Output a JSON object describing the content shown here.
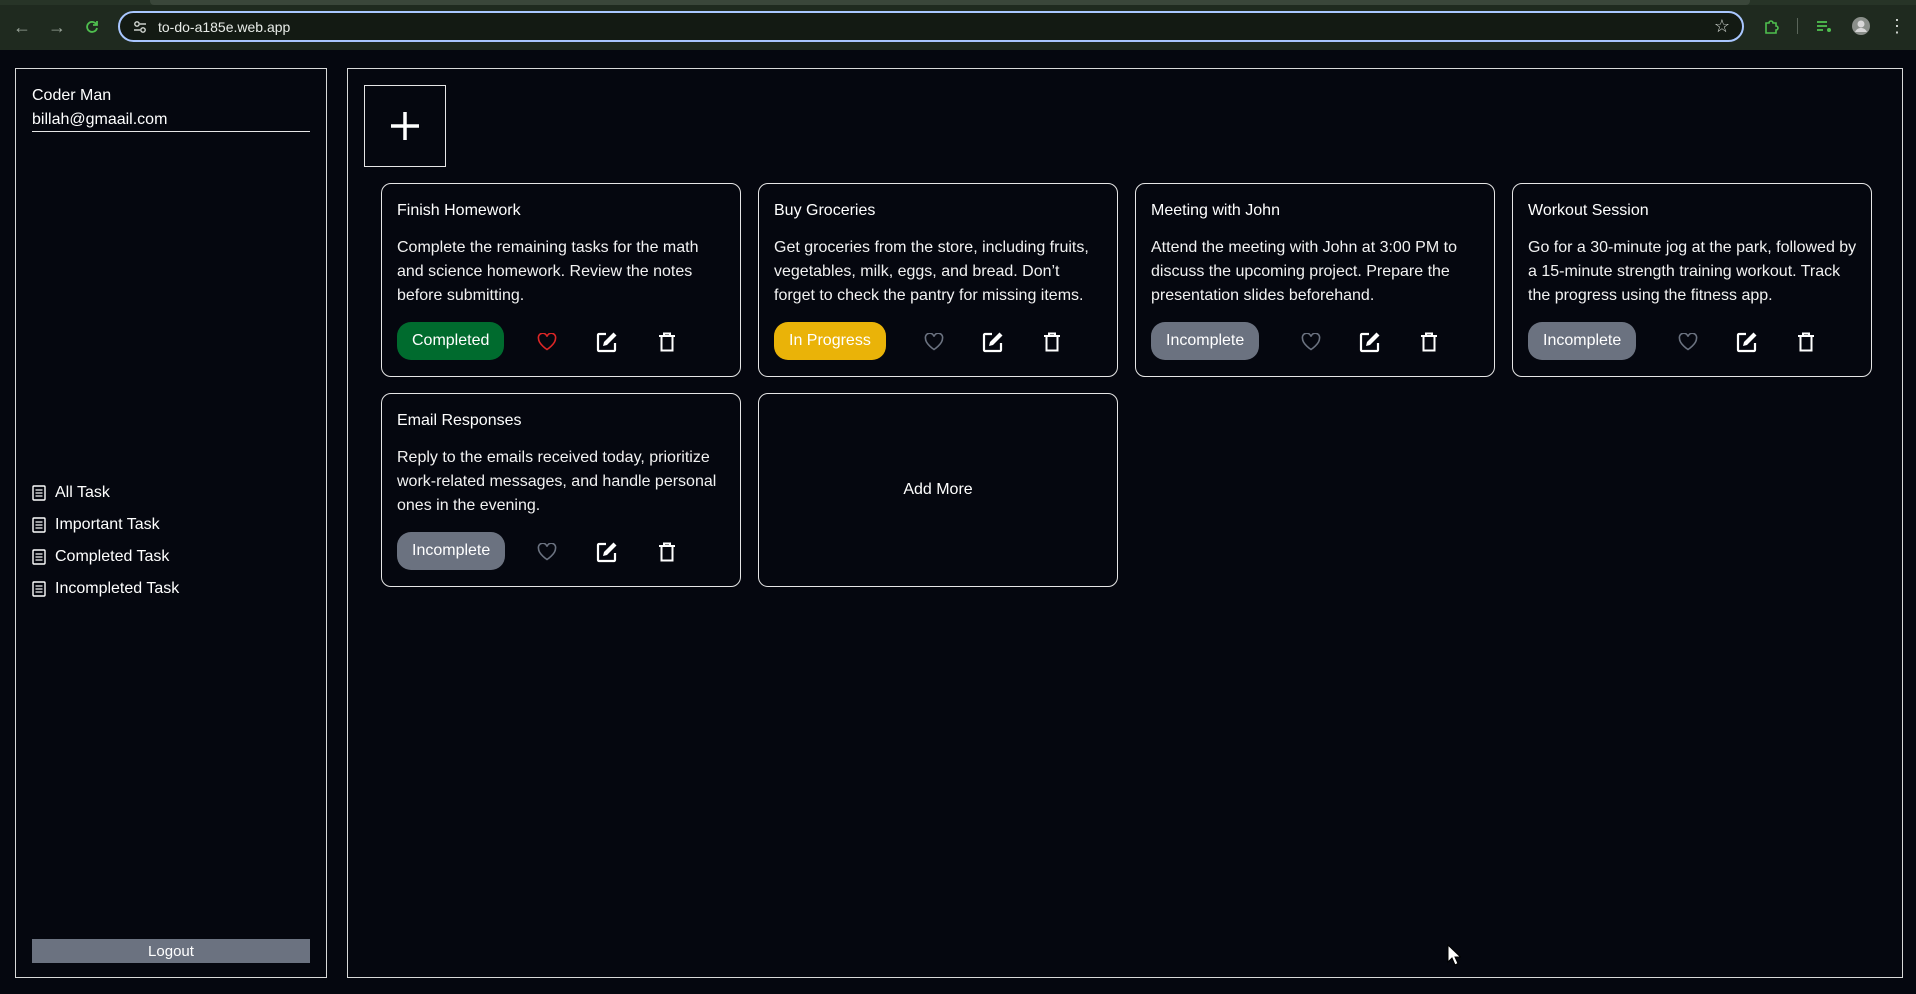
{
  "browser": {
    "url": "to-do-a185e.web.app",
    "back_icon": "arrow-left-icon",
    "forward_icon": "arrow-right-icon",
    "reload_icon": "reload-icon"
  },
  "sidebar": {
    "user_name": "Coder Man",
    "user_email": "billah@gmaail.com",
    "nav": [
      {
        "label": "All Task",
        "icon": "list-icon"
      },
      {
        "label": "Important Task",
        "icon": "list-icon"
      },
      {
        "label": "Completed Task",
        "icon": "list-icon"
      },
      {
        "label": "Incompleted Task",
        "icon": "list-icon"
      }
    ],
    "logout_label": "Logout"
  },
  "main": {
    "add_icon": "plus-icon",
    "add_more_label": "Add More",
    "tasks": [
      {
        "title": "Finish Homework",
        "description": "Complete the remaining tasks for the math and science homework. Review the notes before submitting.",
        "status": "Completed",
        "status_color": "#006b2e",
        "status_text_color": "#ffffff",
        "important": true
      },
      {
        "title": "Buy Groceries",
        "description": "Get groceries from the store, including fruits, vegetables, milk, eggs, and bread. Don’t forget to check the pantry for missing items.",
        "status": "In Progress",
        "status_color": "#eab308",
        "status_text_color": "#ffffff",
        "important": false
      },
      {
        "title": "Meeting with John",
        "description": "Attend the meeting with John at 3:00 PM to discuss the upcoming project. Prepare the presentation slides beforehand.",
        "status": "Incomplete",
        "status_color": "#6b7280",
        "status_text_color": "#ffffff",
        "important": false
      },
      {
        "title": "Workout Session",
        "description": "Go for a 30-minute jog at the park, followed by a 15-minute strength training workout. Track the progress using the fitness app.",
        "status": "Incomplete",
        "status_color": "#6b7280",
        "status_text_color": "#ffffff",
        "important": false
      },
      {
        "title": "Email Responses",
        "description": "Reply to the emails received today, prioritize work-related messages, and handle personal ones in the evening.",
        "status": "Incomplete",
        "status_color": "#6b7280",
        "status_text_color": "#ffffff",
        "important": false
      }
    ]
  },
  "colors": {
    "background": "#05070f",
    "heart_active": "#dc2626",
    "heart_inactive": "#6b7280"
  }
}
